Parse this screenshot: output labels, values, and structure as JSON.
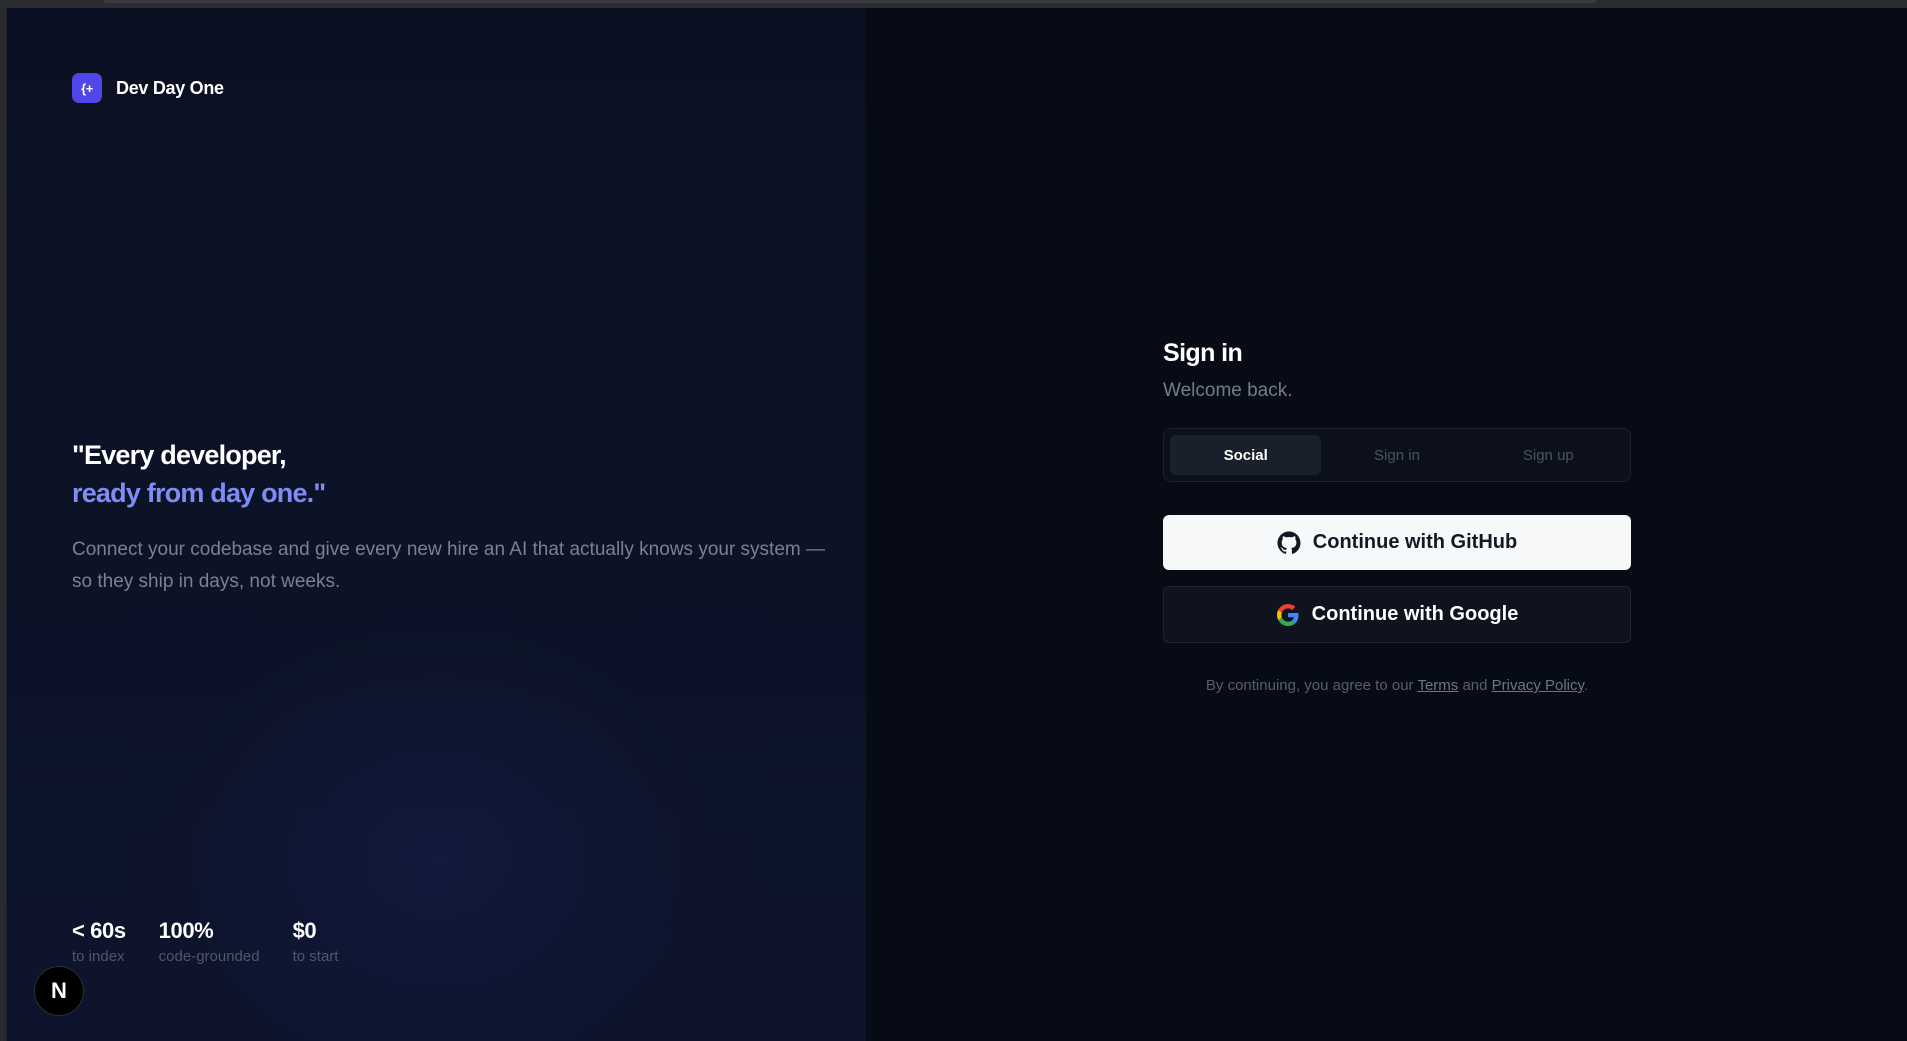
{
  "brand": {
    "logo_mark": "{+",
    "name": "Dev Day One",
    "accent": "#5146e8"
  },
  "hero": {
    "quote_line1": "\"Every developer,",
    "quote_line2": "ready from day one.\"",
    "description": "Connect your codebase and give every new hire an AI that actually knows your system — so they ship in days, not weeks."
  },
  "stats": [
    {
      "value": "< 60s",
      "label": "to index"
    },
    {
      "value": "100%",
      "label": "code-grounded"
    },
    {
      "value": "$0",
      "label": "to start"
    }
  ],
  "dev_badge": {
    "letter": "N"
  },
  "auth": {
    "title": "Sign in",
    "subtitle": "Welcome back.",
    "tabs": [
      {
        "label": "Social",
        "active": true
      },
      {
        "label": "Sign in",
        "active": false
      },
      {
        "label": "Sign up",
        "active": false
      }
    ],
    "github_button": {
      "label": "Continue with GitHub",
      "icon": "github-icon"
    },
    "google_button": {
      "label": "Continue with Google",
      "icon": "google-icon"
    },
    "legal": {
      "prefix": "By continuing, you agree to our ",
      "terms": "Terms",
      "middle": " and ",
      "privacy": "Privacy Policy",
      "suffix": "."
    }
  },
  "colors": {
    "left_bg": "#0b1122",
    "right_bg": "#060b15",
    "hero_accent": "#7f8cf4",
    "github_button_bg": "#f7f8fa"
  }
}
